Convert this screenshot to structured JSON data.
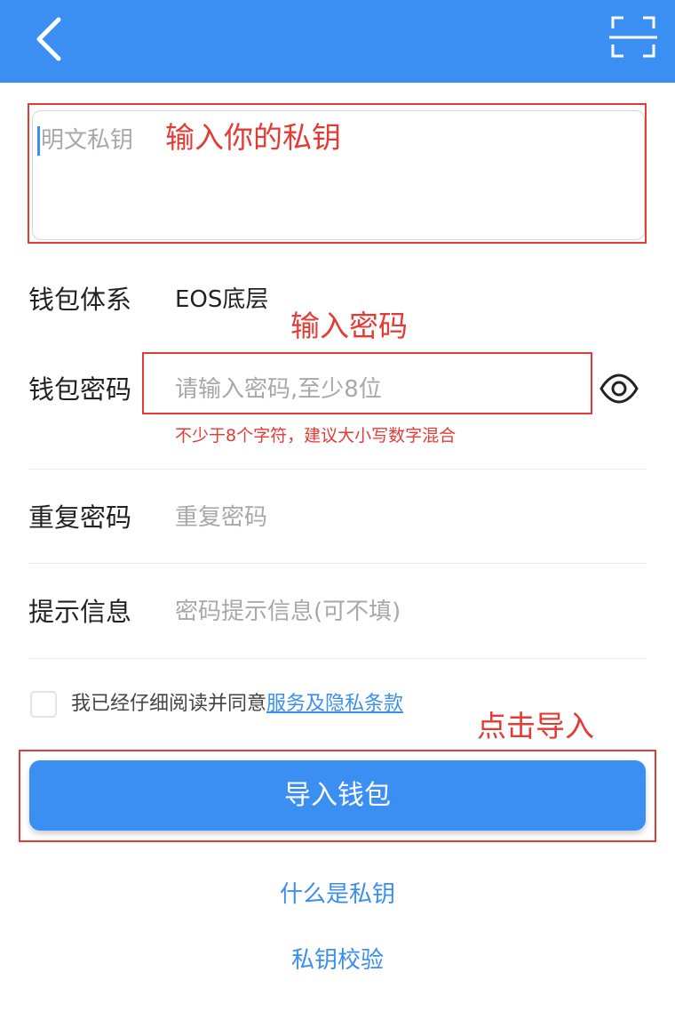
{
  "private_key": {
    "placeholder": "明文私钥"
  },
  "form": {
    "wallet_system_label": "钱包体系",
    "wallet_system_value": "EOS底层",
    "password_label": "钱包密码",
    "password_placeholder": "请输入密码,至少8位",
    "password_hint": "不少于8个字符，建议大小写数字混合",
    "repeat_label": "重复密码",
    "repeat_placeholder": "重复密码",
    "tip_label": "提示信息",
    "tip_placeholder": "密码提示信息(可不填)"
  },
  "agreement": {
    "prefix": "我已经仔细阅读并同意",
    "link": "服务及隐私条款"
  },
  "import_button": "导入钱包",
  "links": {
    "what_is_key": "什么是私钥",
    "key_check": "私钥校验"
  },
  "annotations": {
    "enter_key": "输入你的私钥",
    "enter_password": "输入密码",
    "click_import": "点击导入"
  },
  "icons": {
    "back": "chevron-left-icon",
    "scan": "scan-frame-icon",
    "eye": "eye-icon"
  },
  "colors": {
    "primary": "#3b8ff3",
    "annotation": "#e43b35",
    "placeholder": "#a8a8a8"
  }
}
